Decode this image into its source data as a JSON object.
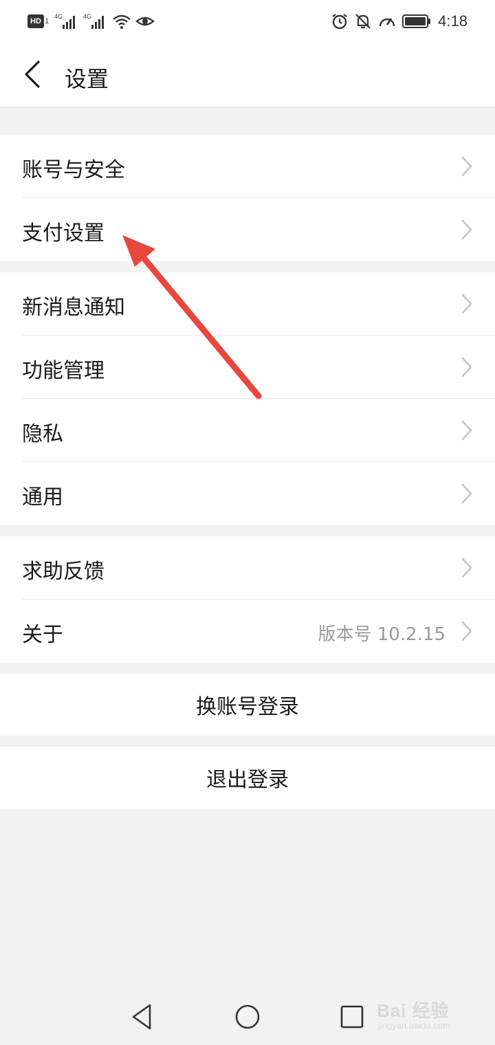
{
  "status_bar": {
    "hd_badge": "HD",
    "sim1_num": "1",
    "network1": "4G",
    "network2": "4G",
    "time": "4:18",
    "icons": [
      "hd-icon",
      "signal-icon",
      "signal-icon",
      "wifi-icon",
      "eye-icon",
      "alarm-icon",
      "bell-off-icon",
      "speed-icon",
      "battery-icon"
    ]
  },
  "header": {
    "title": "设置",
    "back_icon": "chevron-left-icon"
  },
  "groups": [
    {
      "items": [
        {
          "label": "账号与安全"
        },
        {
          "label": "支付设置"
        }
      ]
    },
    {
      "items": [
        {
          "label": "新消息通知"
        },
        {
          "label": "功能管理"
        },
        {
          "label": "隐私"
        },
        {
          "label": "通用"
        }
      ]
    },
    {
      "items": [
        {
          "label": "求助反馈"
        },
        {
          "label": "关于",
          "detail": "版本号 10.2.15"
        }
      ]
    }
  ],
  "actions": {
    "switch_account": "换账号登录",
    "logout": "退出登录"
  },
  "nav_bar": {
    "back": "triangle-back-icon",
    "home": "circle-home-icon",
    "recent": "square-recent-icon"
  },
  "watermark": {
    "brand": "Bai 经验",
    "url": "jingyan.baidu.com"
  },
  "colors": {
    "background": "#f2f2f2",
    "surface": "#ffffff",
    "text": "#1a1a1a",
    "secondary_text": "#9a9a9a",
    "chevron": "#c4c4c4",
    "annotation_arrow": "#e8473b"
  }
}
